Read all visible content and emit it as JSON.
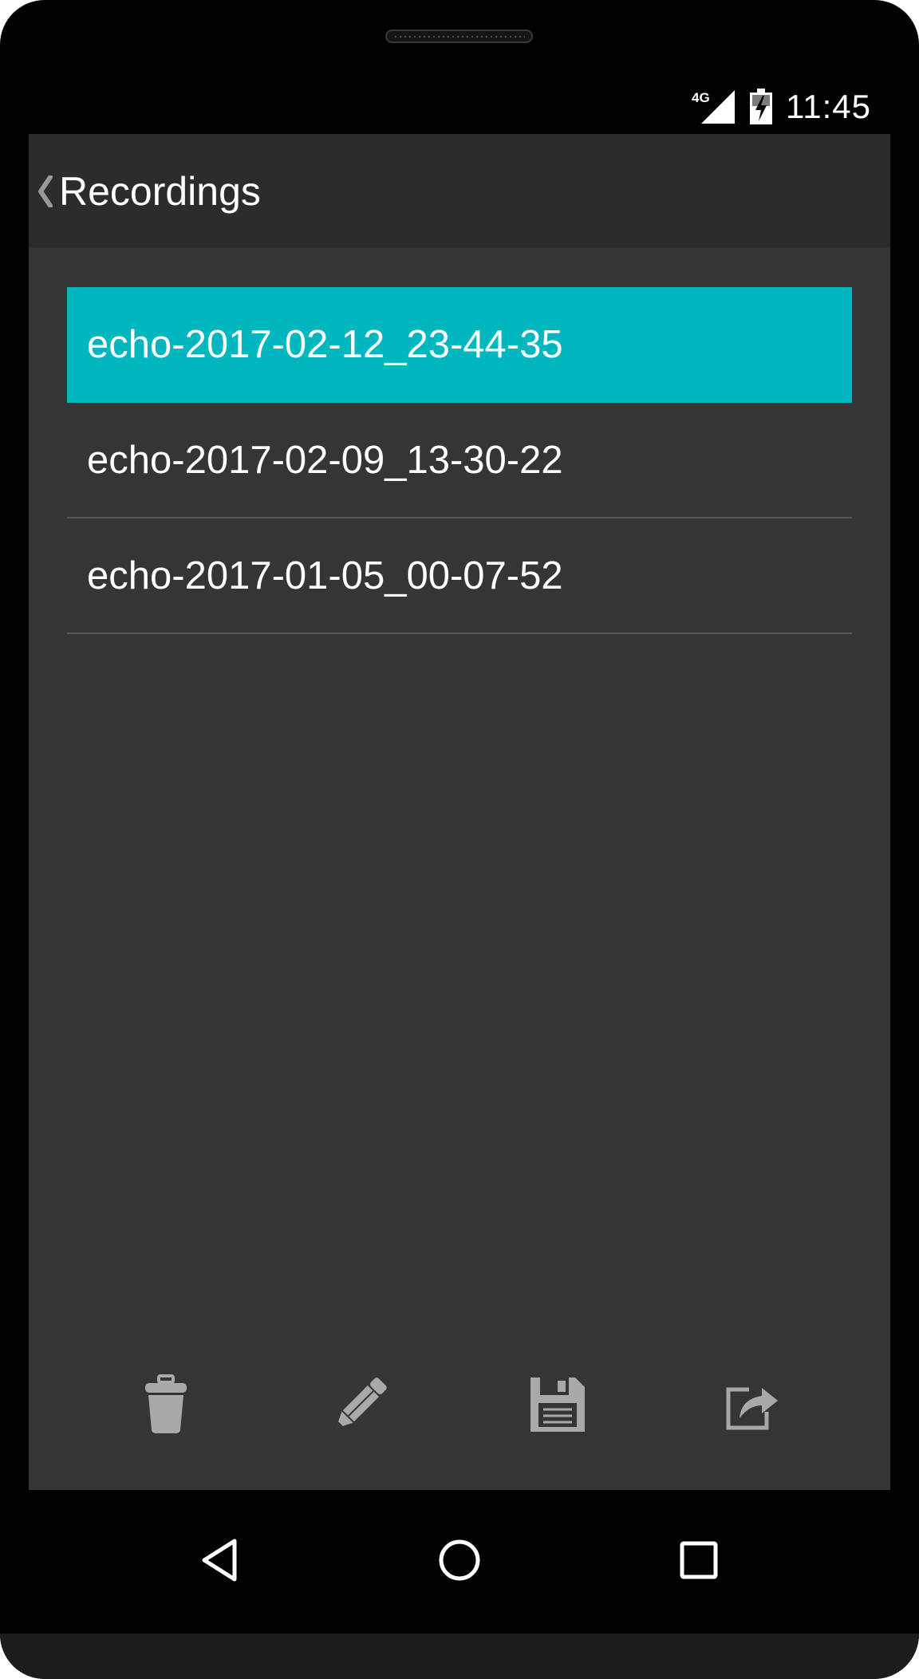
{
  "status_bar": {
    "network": "4G",
    "time": "11:45"
  },
  "action_bar": {
    "back_icon": "chevron-left-icon",
    "title": "Recordings"
  },
  "recordings": [
    {
      "name": "echo-2017-02-12_23-44-35",
      "selected": true
    },
    {
      "name": "echo-2017-02-09_13-30-22",
      "selected": false
    },
    {
      "name": "echo-2017-01-05_00-07-52",
      "selected": false
    }
  ],
  "toolbar": {
    "icons": [
      "trash-icon",
      "pencil-icon",
      "save-icon",
      "share-icon"
    ]
  },
  "navigation": {
    "icons": [
      "back-triangle-icon",
      "home-circle-icon",
      "recents-square-icon"
    ]
  },
  "colors": {
    "accent": "#00b7c0",
    "screen_bg": "#353537",
    "action_bar_bg": "#2c2c2e",
    "icon_gray": "#a9a9ab"
  }
}
